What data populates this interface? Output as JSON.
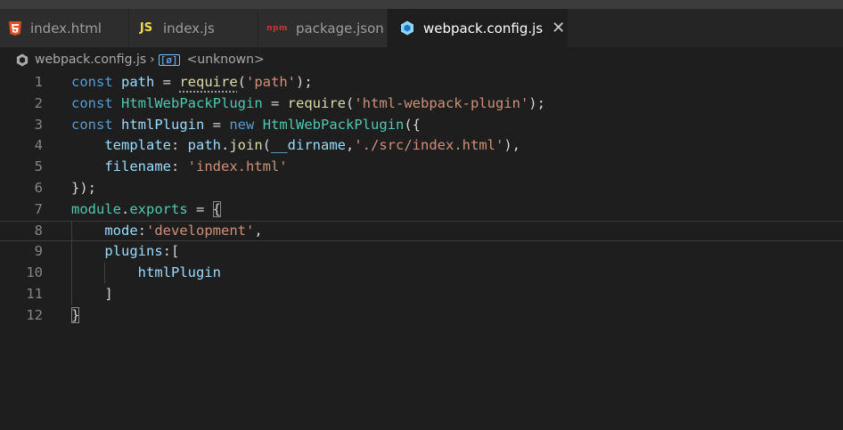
{
  "tabs": [
    {
      "label": "index.html",
      "icon": "html5-icon"
    },
    {
      "label": "index.js",
      "icon_text": "JS",
      "icon": "javascript-icon"
    },
    {
      "label": "package.json",
      "icon_text": "npm",
      "icon": "npm-icon"
    },
    {
      "label": "webpack.config.js",
      "icon": "webpack-icon",
      "active": true,
      "close": "✕"
    }
  ],
  "breadcrumb": {
    "file": "webpack.config.js",
    "separator": "›",
    "symbol_icon": "[ø]",
    "symbol": "<unknown>"
  },
  "editor": {
    "current_line": 8,
    "lines": [
      {
        "n": "1",
        "tokens": [
          [
            "kw",
            "const"
          ],
          [
            "p",
            " "
          ],
          [
            "var",
            "path"
          ],
          [
            "p",
            " = "
          ],
          [
            "fn",
            "require"
          ],
          [
            "p",
            "("
          ],
          [
            "str",
            "'path'"
          ],
          [
            "p",
            ");"
          ]
        ]
      },
      {
        "n": "2",
        "tokens": [
          [
            "kw",
            "const"
          ],
          [
            "p",
            " "
          ],
          [
            "cls",
            "HtmlWebPackPlugin"
          ],
          [
            "p",
            " = "
          ],
          [
            "fn",
            "require"
          ],
          [
            "p",
            "("
          ],
          [
            "str",
            "'html-webpack-plugin'"
          ],
          [
            "p",
            ");"
          ]
        ]
      },
      {
        "n": "3",
        "tokens": [
          [
            "kw",
            "const"
          ],
          [
            "p",
            " "
          ],
          [
            "var",
            "htmlPlugin"
          ],
          [
            "p",
            " = "
          ],
          [
            "kw",
            "new"
          ],
          [
            "p",
            " "
          ],
          [
            "cls",
            "HtmlWebPackPlugin"
          ],
          [
            "p",
            "({"
          ]
        ]
      },
      {
        "n": "4",
        "tokens": [
          [
            "p",
            "    "
          ],
          [
            "var",
            "template"
          ],
          [
            "p",
            ": "
          ],
          [
            "var",
            "path"
          ],
          [
            "p",
            "."
          ],
          [
            "fn",
            "join"
          ],
          [
            "p",
            "("
          ],
          [
            "var",
            "__dirname"
          ],
          [
            "p",
            ","
          ],
          [
            "str",
            "'./src/index.html'"
          ],
          [
            "p",
            "),"
          ]
        ]
      },
      {
        "n": "5",
        "tokens": [
          [
            "p",
            "    "
          ],
          [
            "var",
            "filename"
          ],
          [
            "p",
            ": "
          ],
          [
            "str",
            "'index.html'"
          ]
        ]
      },
      {
        "n": "6",
        "tokens": [
          [
            "p",
            "});"
          ]
        ]
      },
      {
        "n": "7",
        "tokens": [
          [
            "cls",
            "module"
          ],
          [
            "p",
            "."
          ],
          [
            "cls",
            "exports"
          ],
          [
            "p",
            " = "
          ],
          [
            "brk",
            "{"
          ]
        ]
      },
      {
        "n": "8",
        "tokens": [
          [
            "p",
            "    "
          ],
          [
            "var",
            "mode"
          ],
          [
            "p",
            ":"
          ],
          [
            "str",
            "'development'"
          ],
          [
            "p",
            ","
          ]
        ]
      },
      {
        "n": "9",
        "tokens": [
          [
            "p",
            "    "
          ],
          [
            "var",
            "plugins"
          ],
          [
            "p",
            ":["
          ]
        ]
      },
      {
        "n": "10",
        "tokens": [
          [
            "p",
            "        "
          ],
          [
            "var",
            "htmlPlugin"
          ]
        ]
      },
      {
        "n": "11",
        "tokens": [
          [
            "p",
            "    ]"
          ]
        ]
      },
      {
        "n": "12",
        "tokens": [
          [
            "brk",
            "}"
          ]
        ]
      }
    ]
  }
}
